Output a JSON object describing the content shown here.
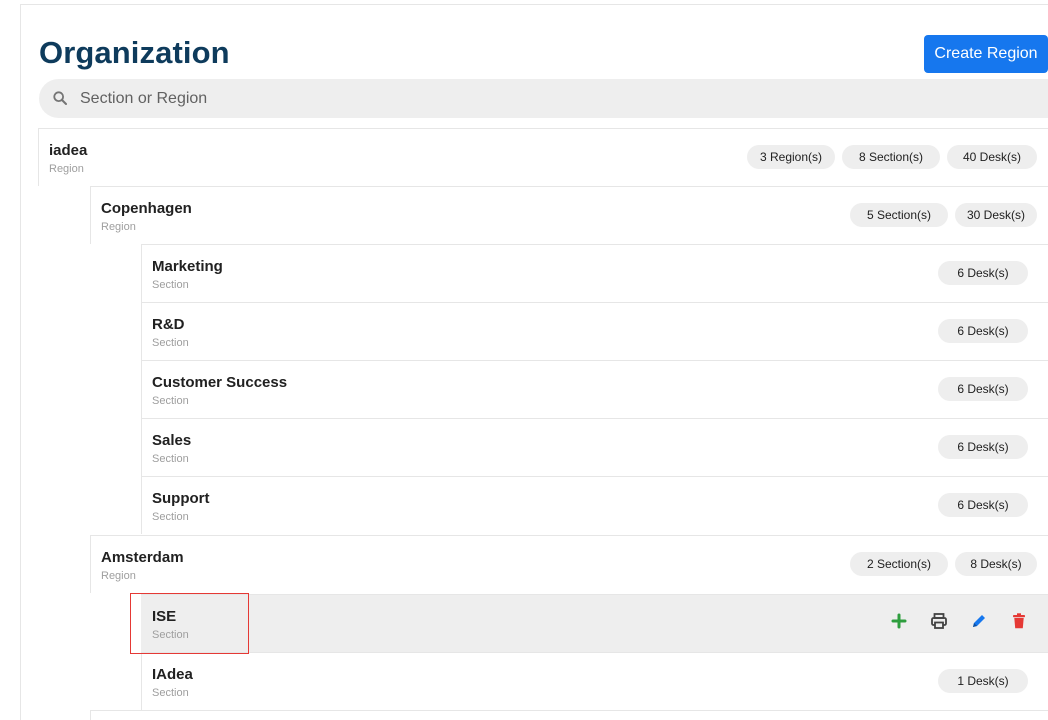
{
  "page": {
    "title": "Organization",
    "create_button": "Create Region"
  },
  "search": {
    "placeholder": "Section or Region",
    "value": ""
  },
  "tree": [
    {
      "name": "iadea",
      "type": "Region",
      "chips": [
        "3 Region(s)",
        "8 Section(s)",
        "40 Desk(s)"
      ]
    },
    {
      "name": "Copenhagen",
      "type": "Region",
      "chips": [
        "5 Section(s)",
        "30 Desk(s)"
      ]
    },
    {
      "name": "Marketing",
      "type": "Section",
      "chips": [
        "6 Desk(s)"
      ]
    },
    {
      "name": "R&D",
      "type": "Section",
      "chips": [
        "6 Desk(s)"
      ]
    },
    {
      "name": "Customer Success",
      "type": "Section",
      "chips": [
        "6 Desk(s)"
      ]
    },
    {
      "name": "Sales",
      "type": "Section",
      "chips": [
        "6 Desk(s)"
      ]
    },
    {
      "name": "Support",
      "type": "Section",
      "chips": [
        "6 Desk(s)"
      ]
    },
    {
      "name": "Amsterdam",
      "type": "Region",
      "chips": [
        "2 Section(s)",
        "8 Desk(s)"
      ]
    },
    {
      "name": "ISE",
      "type": "Section",
      "actions": [
        "plus-icon",
        "print-icon",
        "edit-icon",
        "delete-icon"
      ]
    },
    {
      "name": "IAdea",
      "type": "Section",
      "chips": [
        "1 Desk(s)"
      ]
    }
  ],
  "colors": {
    "primary": "#1677ee",
    "title": "#0e3b5c",
    "add": "#2e9e3e",
    "edit": "#1677ee",
    "delete": "#e53935"
  }
}
